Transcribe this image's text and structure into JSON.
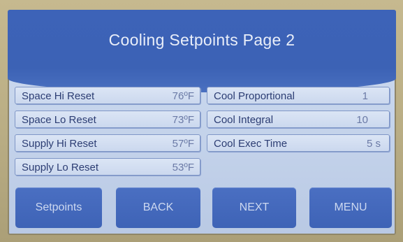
{
  "screen": {
    "title": "Cooling Setpoints Page 2"
  },
  "left_column": [
    {
      "label": "Space Hi Reset",
      "value": "76ºF"
    },
    {
      "label": "Space Lo Reset",
      "value": "73ºF"
    },
    {
      "label": "Supply Hi Reset",
      "value": "57ºF"
    },
    {
      "label": "Supply Lo Reset",
      "value": "53ºF"
    }
  ],
  "right_column": [
    {
      "label": "Cool Proportional",
      "value": "1"
    },
    {
      "label": "Cool Integral",
      "value": "10"
    },
    {
      "label": "Cool Exec Time",
      "value": "5 s"
    }
  ],
  "buttons": {
    "setpoints": "Setpoints",
    "back": "BACK",
    "next": "NEXT",
    "menu": "MENU"
  },
  "colors": {
    "header_blue": "#3d63b8",
    "button_blue": "#4470bf",
    "cell_bg": "#d4e0f2",
    "text_dark": "#2c3d73",
    "bezel": "#b8ab82"
  }
}
